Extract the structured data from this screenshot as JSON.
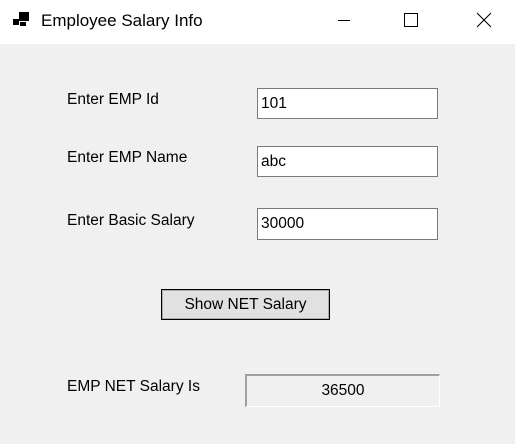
{
  "window": {
    "title": "Employee Salary Info",
    "icon": "app-icon",
    "controls": {
      "minimize_icon": "minimize-icon",
      "maximize_icon": "maximize-icon",
      "close_icon": "close-icon"
    }
  },
  "form": {
    "emp_id": {
      "label": "Enter EMP Id",
      "value": "101"
    },
    "emp_name": {
      "label": "Enter EMP Name",
      "value": "abc"
    },
    "basic_salary": {
      "label": "Enter Basic Salary",
      "value": "30000"
    },
    "show_button_label": "Show NET Salary",
    "net_salary": {
      "label": "EMP NET Salary Is",
      "value": "36500"
    }
  },
  "colors": {
    "background": "#f0f0f0",
    "titlebar": "#ffffff",
    "field_border": "#7a7a7a",
    "button_face": "#e1e1e1"
  }
}
